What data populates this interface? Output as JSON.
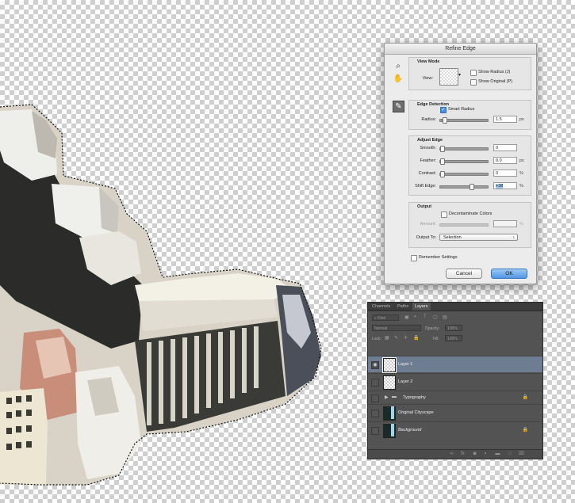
{
  "dialog": {
    "title": "Refine Edge",
    "view_mode": {
      "title": "View Mode",
      "view_label": "View:",
      "show_radius_label": "Show Radius (J)",
      "show_radius_checked": false,
      "show_original_label": "Show Original (P)",
      "show_original_checked": false
    },
    "edge_detection": {
      "title": "Edge Detection",
      "smart_radius_label": "Smart Radius",
      "smart_radius_checked": true,
      "radius_label": "Radius:",
      "radius_value": "1.5",
      "radius_unit": "px",
      "radius_level": 0.06
    },
    "adjust_edge": {
      "title": "Adjust Edge",
      "smooth_label": "Smooth:",
      "smooth_value": "0",
      "smooth_level": 0.0,
      "feather_label": "Feather:",
      "feather_value": "0.0",
      "feather_unit": "px",
      "feather_level": 0.0,
      "contrast_label": "Contrast:",
      "contrast_value": "0",
      "contrast_unit": "%",
      "contrast_level": 0.0,
      "shift_label": "Shift Edge:",
      "shift_value": "+38",
      "shift_unit": "%",
      "shift_level": 0.69
    },
    "output": {
      "title": "Output",
      "decontaminate_label": "Decontaminate Colors",
      "decontaminate_checked": false,
      "amount_label": "Amount:",
      "amount_value": "",
      "amount_unit": "%",
      "output_to_label": "Output To:",
      "output_to_value": "Selection"
    },
    "remember_label": "Remember Settings",
    "remember_checked": false,
    "cancel_label": "Cancel",
    "ok_label": "OK"
  },
  "layers_panel": {
    "tabs": [
      "Channels",
      "Paths",
      "Layers"
    ],
    "active_tab": "Layers",
    "filter_kind": "Kind",
    "blend_mode": "Normal",
    "opacity_label": "Opacity:",
    "opacity_value": "100%",
    "lock_label": "Lock:",
    "fill_label": "Fill:",
    "fill_value": "100%",
    "layers": [
      {
        "name": "Layer 1",
        "selected": true,
        "visible": true
      },
      {
        "name": "Layer 2",
        "selected": false,
        "visible": false
      },
      {
        "name": "Typography",
        "selected": false,
        "visible": false,
        "group": true,
        "locked": true
      },
      {
        "name": "Original Cityscape",
        "selected": false,
        "visible": false
      },
      {
        "name": "Background",
        "selected": false,
        "visible": false,
        "italic": true,
        "locked": true
      }
    ]
  }
}
